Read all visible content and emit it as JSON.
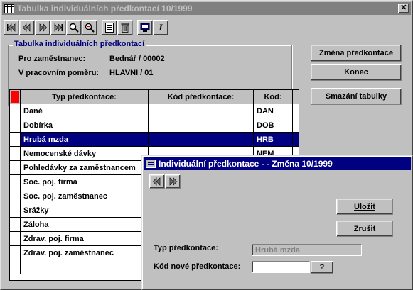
{
  "main_window": {
    "title": "Tabulka individuálních předkontací  10/1999",
    "close_label": "✕"
  },
  "toolbar": {
    "buttons": [
      {
        "name": "first-record-icon"
      },
      {
        "name": "prev-record-icon"
      },
      {
        "name": "next-record-icon"
      },
      {
        "name": "last-record-icon"
      },
      {
        "name": "search-icon"
      },
      {
        "name": "zoom-out-icon"
      },
      {
        "name": "list-icon"
      },
      {
        "name": "trash-icon"
      },
      {
        "name": "monitor-icon"
      },
      {
        "name": "italic-info-icon",
        "label": "I"
      }
    ]
  },
  "info_group": {
    "legend": "Tabulka individuálních předkontací",
    "employee_label": "Pro zaměstnanec:",
    "employee_value": "Bednář / 00002",
    "employment_label": "V pracovním poměru:",
    "employment_value": "HLAVNI / 01"
  },
  "side_buttons": {
    "change": "Změna předkontace",
    "close": "Konec",
    "delete_table": "Smazání tabulky"
  },
  "grid": {
    "columns": [
      "Typ předkontace:",
      "Kód předkontace:",
      "Kód:"
    ],
    "rows": [
      {
        "type": "Daně",
        "kod_predkontace": "",
        "kod": "DAN"
      },
      {
        "type": "Dobírka",
        "kod_predkontace": "",
        "kod": "DOB"
      },
      {
        "type": "Hrubá mzda",
        "kod_predkontace": "",
        "kod": "HRB",
        "selected": true
      },
      {
        "type": "Nemocenské dávky",
        "kod_predkontace": "",
        "kod": "NEM"
      },
      {
        "type": "Pohledávky za zaměstnancem",
        "kod_predkontace": "",
        "kod": ""
      },
      {
        "type": "Soc. poj. firma",
        "kod_predkontace": "",
        "kod": ""
      },
      {
        "type": "Soc. poj. zaměstnanec",
        "kod_predkontace": "",
        "kod": ""
      },
      {
        "type": "Srážky",
        "kod_predkontace": "",
        "kod": ""
      },
      {
        "type": "Záloha",
        "kod_predkontace": "",
        "kod": ""
      },
      {
        "type": "Zdrav. poj. firma",
        "kod_predkontace": "",
        "kod": ""
      },
      {
        "type": "Zdrav. poj. zaměstnanec",
        "kod_predkontace": "",
        "kod": ""
      },
      {
        "type": "",
        "kod_predkontace": "",
        "kod": ""
      }
    ]
  },
  "dialog": {
    "title": "Individuální předkontace -  - Změna  10/1999",
    "save": "Uložit",
    "cancel": "Zrušit",
    "type_label": "Typ předkontace:",
    "type_value": "Hrubá mzda",
    "new_code_label": "Kód nové předkontace:",
    "new_code_value": "",
    "lookup": "?"
  }
}
